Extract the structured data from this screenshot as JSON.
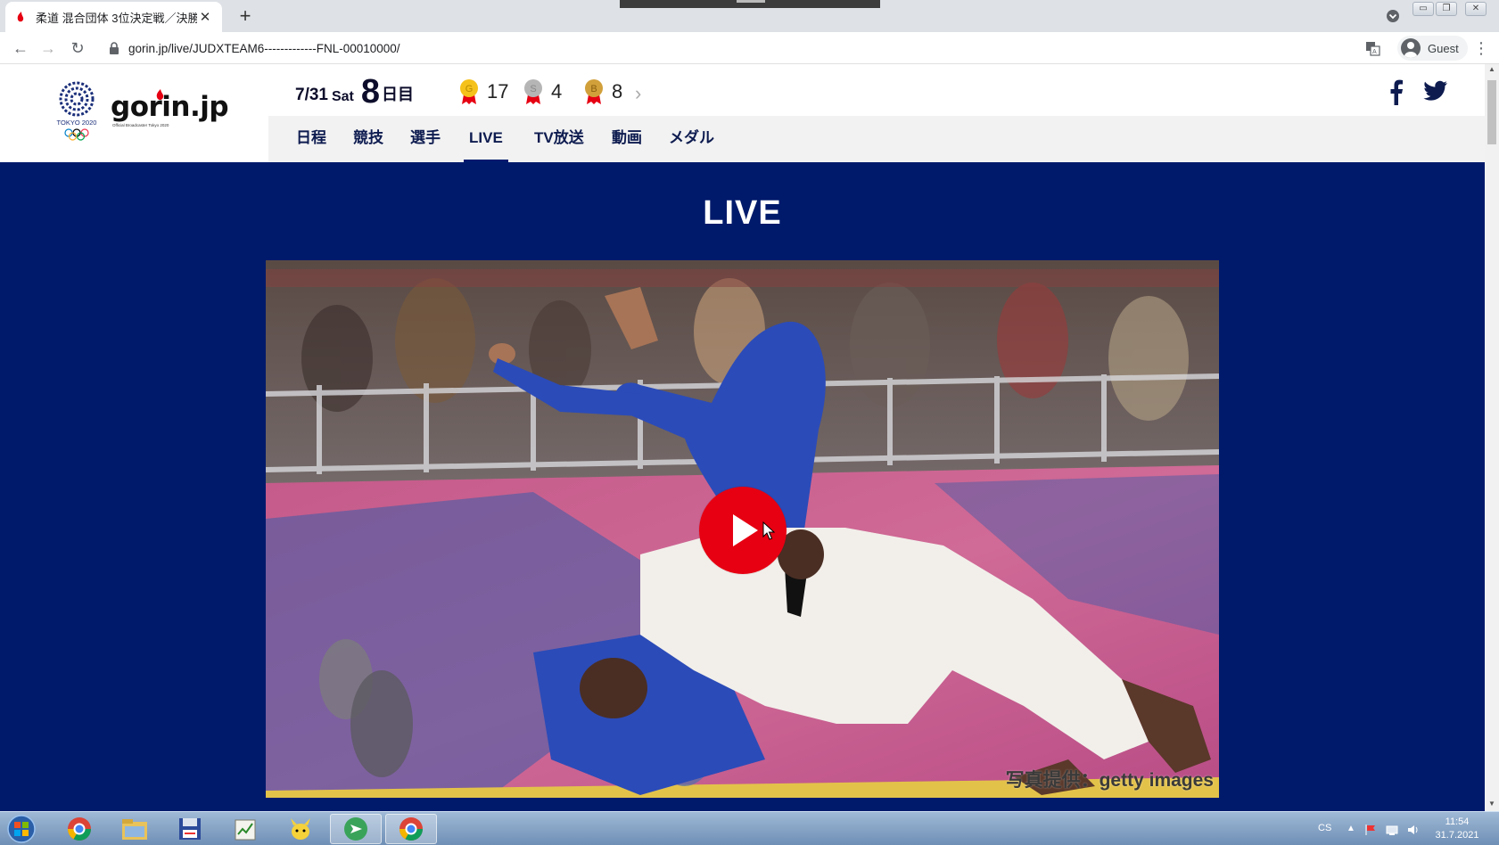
{
  "browser": {
    "tab_title": "柔道 混合団体 3位決定戦／決勝",
    "url": "gorin.jp/live/JUDXTEAM6-------------FNL-00010000/",
    "profile_label": "Guest"
  },
  "site": {
    "logo_text": "gorin.jp",
    "logo_sub": "Official Broadcaster Tokyo 2020",
    "emblem_text": "TOKYO 2020"
  },
  "date": {
    "month_day": "7/31",
    "weekday": "Sat",
    "day_number": "8",
    "day_suffix": "日目"
  },
  "medals": [
    {
      "letter": "G",
      "count": "17",
      "color": "#f5c21b"
    },
    {
      "letter": "S",
      "count": "4",
      "color": "#b5b5b5"
    },
    {
      "letter": "B",
      "count": "8",
      "color": "#d1a03a"
    }
  ],
  "nav": [
    "日程",
    "競技",
    "選手",
    "LIVE",
    "TV放送",
    "動画",
    "メダル"
  ],
  "active_nav": "LIVE",
  "hero": {
    "title": "LIVE",
    "photo_credit": "写真提供：getty images"
  },
  "taskbar": {
    "lang": "CS",
    "time": "11:54",
    "date": "31.7.2021"
  },
  "colors": {
    "hero_bg": "#001a6b",
    "play_button": "#e60012",
    "nav_text": "#0d1b4f"
  }
}
